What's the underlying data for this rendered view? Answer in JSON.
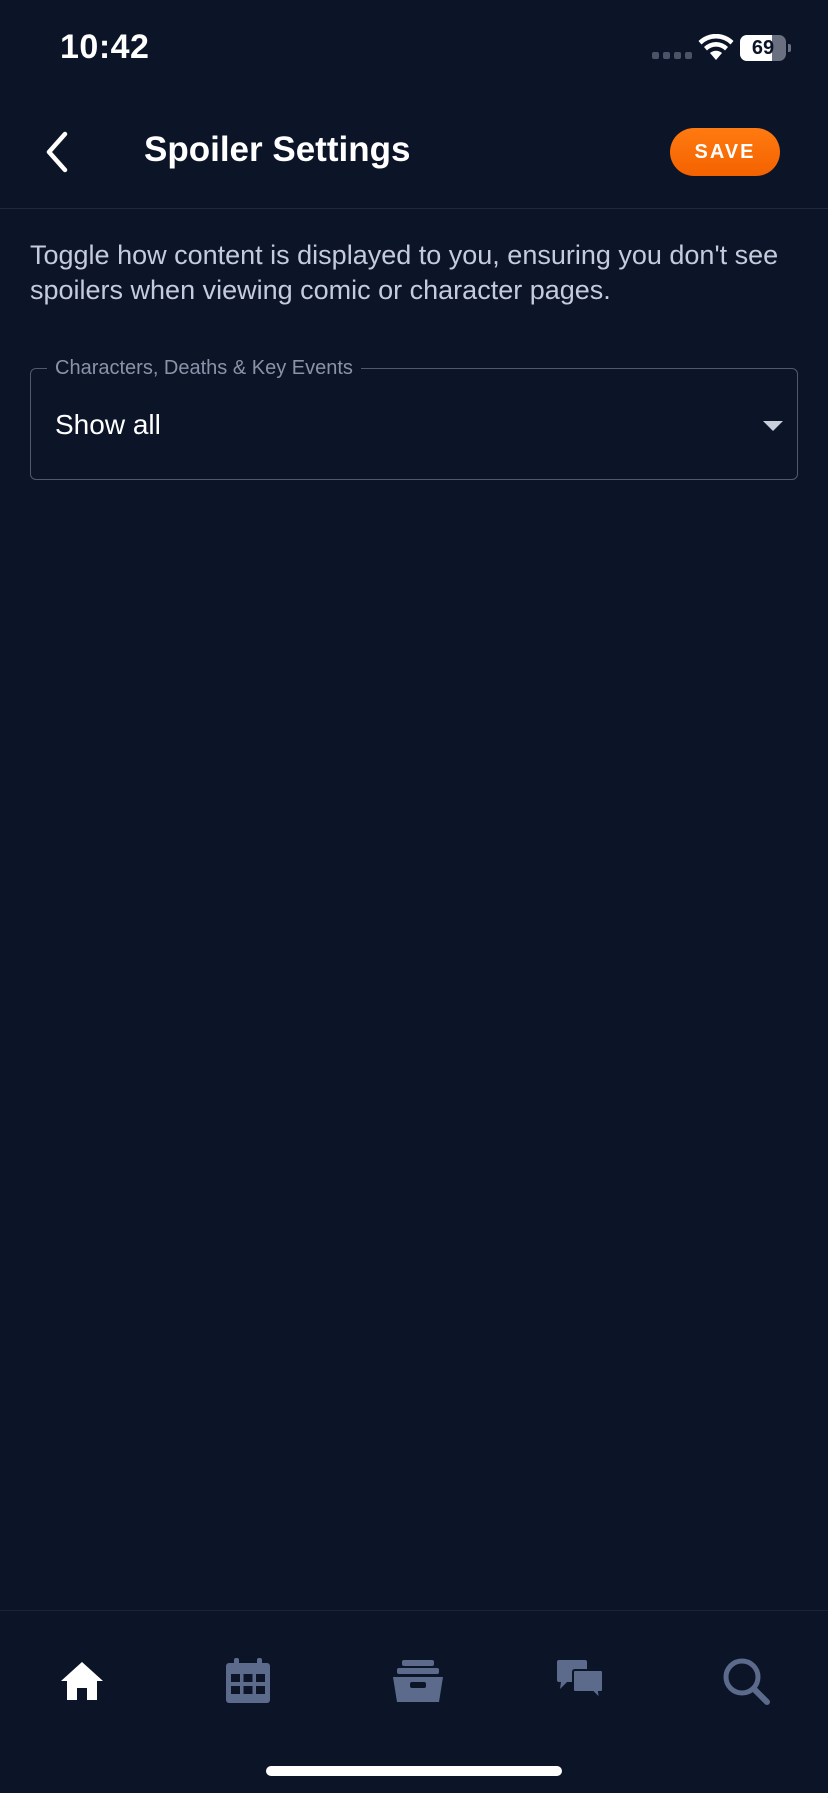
{
  "status_bar": {
    "time": "10:42",
    "battery_level": "69",
    "battery_fraction": 0.69
  },
  "header": {
    "title": "Spoiler Settings",
    "save_label": "SAVE",
    "back_icon": "chevron-left-icon"
  },
  "description": "Toggle how content is displayed to you, ensuring you don't see spoilers when viewing comic or character pages.",
  "spoiler_select": {
    "label": "Characters, Deaths & Key Events",
    "value": "Show all"
  },
  "tab_bar": {
    "items": [
      {
        "icon": "home-icon",
        "active": true
      },
      {
        "icon": "calendar-icon",
        "active": false
      },
      {
        "icon": "archive-box-icon",
        "active": false
      },
      {
        "icon": "chat-icon",
        "active": false
      },
      {
        "icon": "search-icon",
        "active": false
      }
    ]
  },
  "colors": {
    "background": "#0c1428",
    "accent": "#f46200",
    "inactive_icon": "#5c6a8c",
    "active_icon": "#ffffff"
  }
}
